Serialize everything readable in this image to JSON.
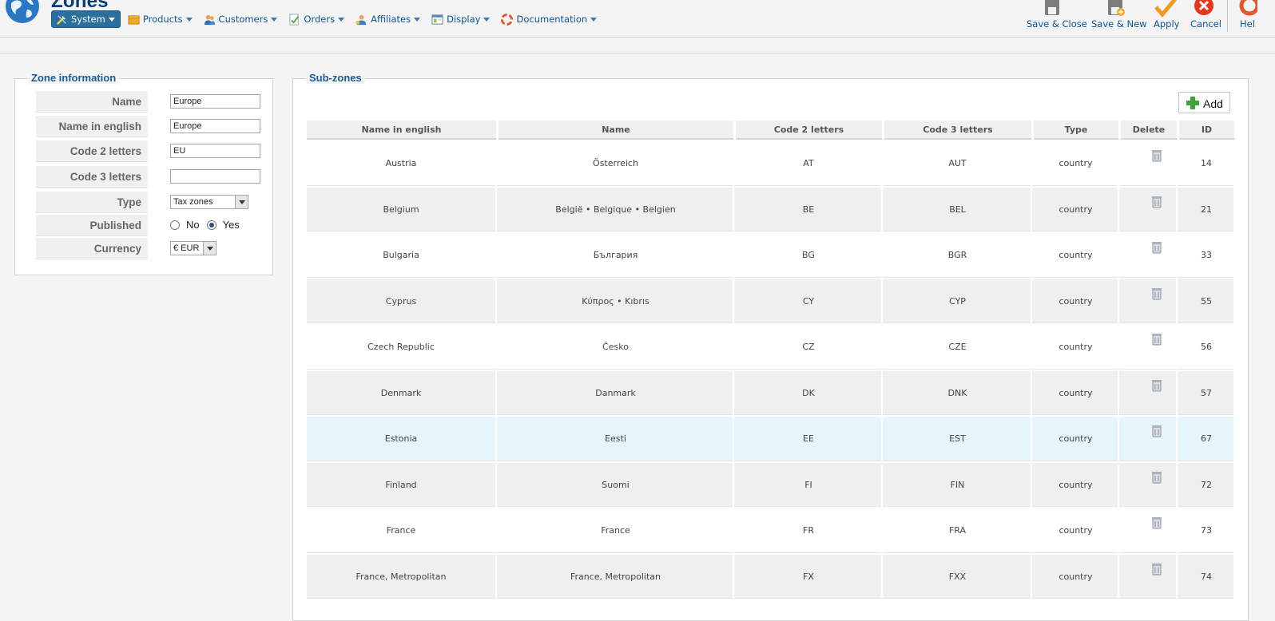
{
  "page": {
    "title": "Zones"
  },
  "menu": [
    {
      "label": "System",
      "icon": "tools-icon",
      "active": true
    },
    {
      "label": "Products",
      "icon": "products-box-icon",
      "active": false
    },
    {
      "label": "Customers",
      "icon": "customers-icon",
      "active": false
    },
    {
      "label": "Orders",
      "icon": "orders-icon",
      "active": false
    },
    {
      "label": "Affiliates",
      "icon": "affiliates-icon",
      "active": false
    },
    {
      "label": "Display",
      "icon": "display-icon",
      "active": false
    },
    {
      "label": "Documentation",
      "icon": "lifebuoy-icon",
      "active": false
    }
  ],
  "toolbar": {
    "save_close": "Save & Close",
    "save_new": "Save & New",
    "apply": "Apply",
    "cancel": "Cancel",
    "help": "Hel"
  },
  "zone_info": {
    "legend": "Zone information",
    "name_label": "Name",
    "name_value": "Europe",
    "name_en_label": "Name in english",
    "name_en_value": "Europe",
    "code2_label": "Code 2 letters",
    "code2_value": "EU",
    "code3_label": "Code 3 letters",
    "code3_value": "",
    "type_label": "Type",
    "type_value": "Tax zones",
    "published_label": "Published",
    "published_no": "No",
    "published_yes": "Yes",
    "published_selected": "Yes",
    "currency_label": "Currency",
    "currency_value": "€ EUR"
  },
  "subzones": {
    "legend": "Sub-zones",
    "add_label": "Add",
    "columns": [
      "Name in english",
      "Name",
      "Code 2 letters",
      "Code 3 letters",
      "Type",
      "Delete",
      "ID"
    ],
    "rows": [
      {
        "name_en": "Austria",
        "name": "Österreich",
        "code2": "AT",
        "code3": "AUT",
        "type": "country",
        "id": "14"
      },
      {
        "name_en": "Belgium",
        "name": "België • Belgique • Belgien",
        "code2": "BE",
        "code3": "BEL",
        "type": "country",
        "id": "21"
      },
      {
        "name_en": "Bulgaria",
        "name": "България",
        "code2": "BG",
        "code3": "BGR",
        "type": "country",
        "id": "33"
      },
      {
        "name_en": "Cyprus",
        "name": "Κύπρος • Kıbrıs",
        "code2": "CY",
        "code3": "CYP",
        "type": "country",
        "id": "55"
      },
      {
        "name_en": "Czech Republic",
        "name": "Česko",
        "code2": "CZ",
        "code3": "CZE",
        "type": "country",
        "id": "56"
      },
      {
        "name_en": "Denmark",
        "name": "Danmark",
        "code2": "DK",
        "code3": "DNK",
        "type": "country",
        "id": "57"
      },
      {
        "name_en": "Estonia",
        "name": "Eesti",
        "code2": "EE",
        "code3": "EST",
        "type": "country",
        "id": "67"
      },
      {
        "name_en": "Finland",
        "name": "Suomi",
        "code2": "FI",
        "code3": "FIN",
        "type": "country",
        "id": "72"
      },
      {
        "name_en": "France",
        "name": "France",
        "code2": "FR",
        "code3": "FRA",
        "type": "country",
        "id": "73"
      },
      {
        "name_en": "France, Metropolitan",
        "name": "France, Metropolitan",
        "code2": "FX",
        "code3": "FXX",
        "type": "country",
        "id": "74"
      }
    ],
    "highlighted_row": "Estonia"
  },
  "colors": {
    "link": "#0b5597",
    "row_alt": "#efefef",
    "row_hover": "#e6f4fb",
    "legend": "#1a5a96"
  }
}
